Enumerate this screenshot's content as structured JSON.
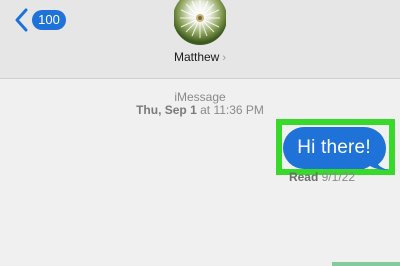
{
  "header": {
    "back_badge": "100",
    "contact_name": "Matthew",
    "contact_chevron": "›"
  },
  "conversation": {
    "service": "iMessage",
    "timestamp_day": "Thu, Sep 1",
    "timestamp_rest": " at 11:36 PM",
    "messages": [
      {
        "direction": "sent",
        "text": "Hi there!"
      }
    ],
    "read_label": "Read",
    "read_date": " 9/1/22"
  },
  "colors": {
    "bubble": "#1f73d8",
    "highlight": "#37d92b",
    "background": "#f0f0f0"
  },
  "icons": {
    "back": "chevron-left-icon",
    "avatar": "dandelion-photo"
  }
}
